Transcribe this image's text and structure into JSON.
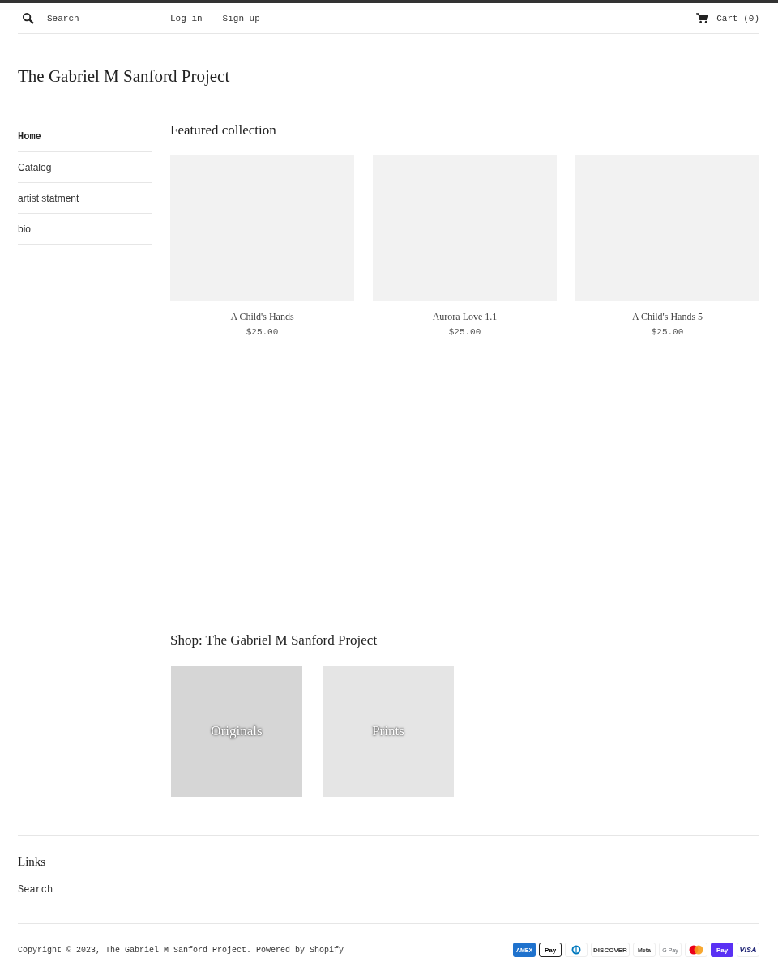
{
  "header": {
    "search": {
      "placeholder": "Search"
    },
    "links": [
      "Log in",
      "Sign up"
    ],
    "cart": "Cart (0)"
  },
  "site_title": "The Gabriel M Sanford Project",
  "sidebar": {
    "items": [
      {
        "label": "Home",
        "selected": true
      },
      {
        "label": "Catalog",
        "selected": false
      },
      {
        "label": "artist statment",
        "selected": false
      },
      {
        "label": "bio",
        "selected": false
      }
    ]
  },
  "featured": {
    "heading": "Featured collection",
    "products": [
      {
        "title": "A Child's Hands",
        "price": "$25.00"
      },
      {
        "title": "Aurora Love 1.1",
        "price": "$25.00"
      },
      {
        "title": "A Child's Hands 5",
        "price": "$25.00"
      }
    ]
  },
  "shop": {
    "heading": "Shop: The Gabriel M Sanford Project",
    "collections": [
      {
        "label": "Originals",
        "color": "#d6d6d6"
      },
      {
        "label": "Prints",
        "color": "#e5e5e5"
      }
    ]
  },
  "footer": {
    "links_heading": "Links",
    "links": [
      "Search"
    ],
    "copyright": "Copyright © 2023, The Gabriel M Sanford Project. Powered by Shopify",
    "payments": [
      {
        "kind": "amex",
        "label": "AMEX"
      },
      {
        "kind": "applepay",
        "label": "Pay"
      },
      {
        "kind": "diners"
      },
      {
        "kind": "discover",
        "label": "DISCOVER"
      },
      {
        "kind": "meta",
        "label": "Meta"
      },
      {
        "kind": "gpay",
        "label": "G Pay"
      },
      {
        "kind": "mastercard"
      },
      {
        "kind": "shoppay",
        "label": "Pay"
      },
      {
        "kind": "visa",
        "label": "VISA"
      }
    ]
  }
}
